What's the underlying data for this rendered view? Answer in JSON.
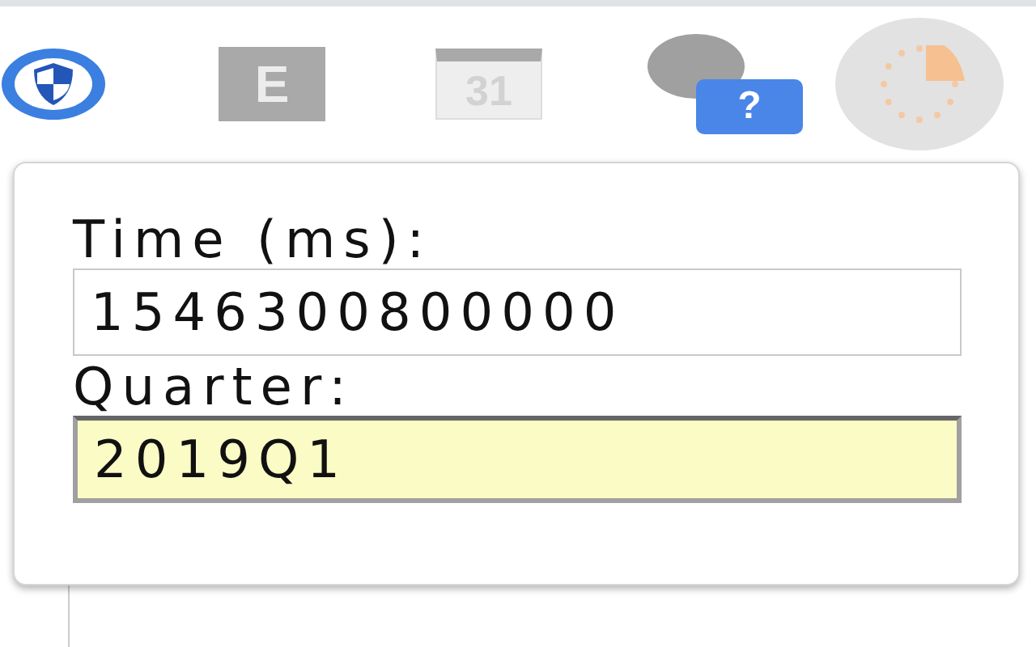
{
  "toolbar": {
    "icons": [
      {
        "kind": "shield"
      },
      {
        "kind": "letter",
        "glyph": "E"
      },
      {
        "kind": "calendar",
        "glyph": "31"
      },
      {
        "kind": "chat-help",
        "glyph": "?"
      },
      {
        "kind": "clock"
      }
    ]
  },
  "popup": {
    "fields": [
      {
        "label": "Time (ms):",
        "value": "1546300800000",
        "highlighted": false
      },
      {
        "label": "Quarter:",
        "value": "2019Q1",
        "highlighted": true
      }
    ]
  }
}
